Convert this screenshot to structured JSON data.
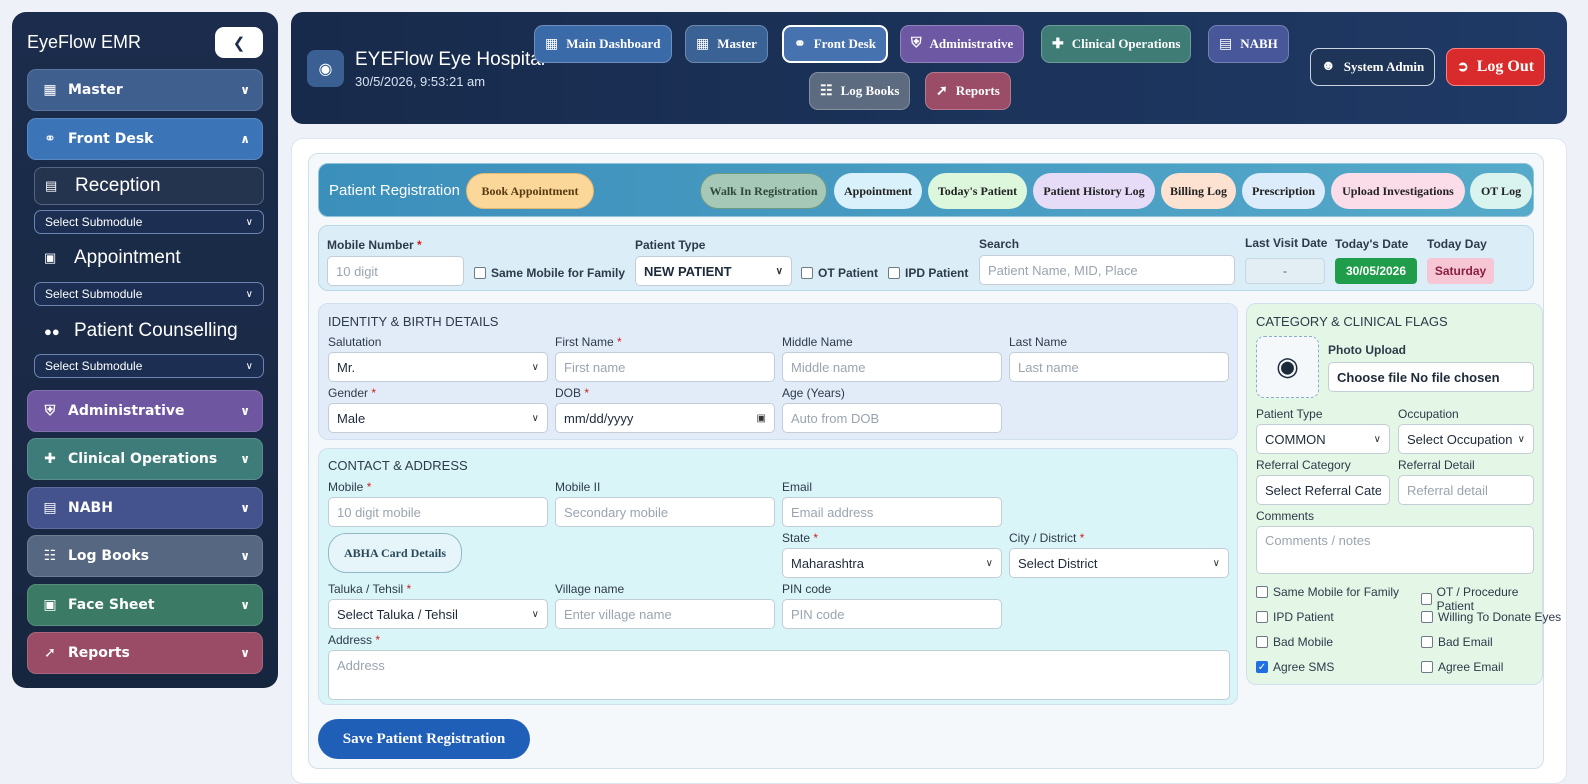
{
  "sidebar": {
    "title": "EyeFlow EMR",
    "collapse_icon": "chevron-left-icon",
    "items": [
      {
        "label": "Master",
        "icon": "grid-plus-icon",
        "color": "#3f5f8f"
      },
      {
        "label": "Front Desk",
        "icon": "headset-icon",
        "color": "#3c74b8"
      },
      {
        "label": "Administrative",
        "icon": "admin-shield-icon",
        "color": "#6e57a0"
      },
      {
        "label": "Clinical Operations",
        "icon": "medkit-icon",
        "color": "#3d7c78"
      },
      {
        "label": "NABH",
        "icon": "clipboard-icon",
        "color": "#44528e"
      },
      {
        "label": "Log Books",
        "icon": "book-icon",
        "color": "#566781"
      },
      {
        "label": "Face Sheet",
        "icon": "id-card-icon",
        "color": "#3b7a64"
      },
      {
        "label": "Reports",
        "icon": "chart-line-icon",
        "color": "#9a4c66"
      }
    ],
    "submodules": [
      {
        "label": "Reception",
        "icon": "reception-icon",
        "select": "Select Submodule"
      },
      {
        "label": "Appointment",
        "icon": "calendar-icon",
        "select": "Select Submodule"
      },
      {
        "label": "Patient Counselling",
        "icon": "users-icon",
        "select": "Select Submodule"
      }
    ]
  },
  "header": {
    "hospital": "EYEFlow Eye Hospital",
    "datetime": "30/5/2026, 9:53:21 am",
    "nav": [
      {
        "label": "Main Dashboard",
        "icon": "dashboard-icon"
      },
      {
        "label": "Master",
        "icon": "grid-plus-icon"
      },
      {
        "label": "Front Desk",
        "icon": "headset-icon"
      },
      {
        "label": "Administrative",
        "icon": "admin-shield-icon"
      },
      {
        "label": "Clinical Operations",
        "icon": "medkit-icon"
      },
      {
        "label": "NABH",
        "icon": "clipboard-icon"
      },
      {
        "label": "Log Books",
        "icon": "book-icon"
      },
      {
        "label": "Reports",
        "icon": "chart-line-icon"
      }
    ],
    "user": "System Admin",
    "logout": "Log Out"
  },
  "tabs": {
    "title": "Patient Registration",
    "book": "Book Appointment",
    "items": [
      "Walk In Registration",
      "Appointment",
      "Today's Patient",
      "Patient History Log",
      "Billing Log",
      "Prescription",
      "Upload Investigations",
      "OT Log"
    ]
  },
  "top_fields": {
    "mobile_label": "Mobile Number",
    "mobile_ph": "10 digit",
    "same_mobile": "Same Mobile for Family",
    "ptype_label": "Patient Type",
    "ptype_value": "NEW PATIENT",
    "ot_patient": "OT Patient",
    "ipd_patient": "IPD Patient",
    "search_label": "Search",
    "search_ph": "Patient Name, MID, Place",
    "last_visit_label": "Last Visit Date",
    "last_visit_value": "-",
    "today_label": "Today's Date",
    "today_value": "30/05/2026",
    "day_label": "Today Day",
    "day_value": "Saturday"
  },
  "identity": {
    "title": "IDENTITY & BIRTH DETAILS",
    "salutation_label": "Salutation",
    "salutation_value": "Mr.",
    "first_label": "First Name",
    "first_ph": "First name",
    "middle_label": "Middle Name",
    "middle_ph": "Middle name",
    "last_label": "Last Name",
    "last_ph": "Last name",
    "gender_label": "Gender",
    "gender_value": "Male",
    "dob_label": "DOB",
    "dob_ph": "mm/dd/yyyy",
    "age_label": "Age (Years)",
    "age_ph": "Auto from DOB"
  },
  "contact": {
    "title": "CONTACT & ADDRESS",
    "mobile_label": "Mobile",
    "mobile_ph": "10 digit mobile",
    "mobile2_label": "Mobile II",
    "mobile2_ph": "Secondary mobile",
    "email_label": "Email",
    "email_ph": "Email address",
    "abha": "ABHA Card Details",
    "state_label": "State",
    "state_value": "Maharashtra",
    "city_label": "City / District",
    "city_value": "Select District",
    "taluka_label": "Taluka / Tehsil",
    "taluka_value": "Select Taluka / Tehsil",
    "village_label": "Village name",
    "village_ph": "Enter village name",
    "pin_label": "PIN code",
    "pin_ph": "PIN code",
    "address_label": "Address",
    "address_ph": "Address"
  },
  "category": {
    "title": "CATEGORY & CLINICAL FLAGS",
    "photo_label": "Photo Upload",
    "file_btn": "Choose file No file chosen",
    "ptype_label": "Patient Type",
    "ptype_value": "COMMON",
    "occupation_label": "Occupation",
    "occupation_value": "Select Occupation",
    "ref_cat_label": "Referral Category",
    "ref_cat_value": "Select Referral Category",
    "ref_detail_label": "Referral Detail",
    "ref_detail_ph": "Referral detail",
    "comments_label": "Comments",
    "comments_ph": "Comments / notes",
    "flags": [
      {
        "label": "Same Mobile for Family",
        "checked": false
      },
      {
        "label": "OT / Procedure Patient",
        "checked": false
      },
      {
        "label": "IPD Patient",
        "checked": false
      },
      {
        "label": "Willing To Donate Eyes",
        "checked": false
      },
      {
        "label": "Bad Mobile",
        "checked": false
      },
      {
        "label": "Bad Email",
        "checked": false
      },
      {
        "label": "Agree SMS",
        "checked": true
      },
      {
        "label": "Agree Email",
        "checked": false
      }
    ]
  },
  "save_label": "Save Patient Registration"
}
